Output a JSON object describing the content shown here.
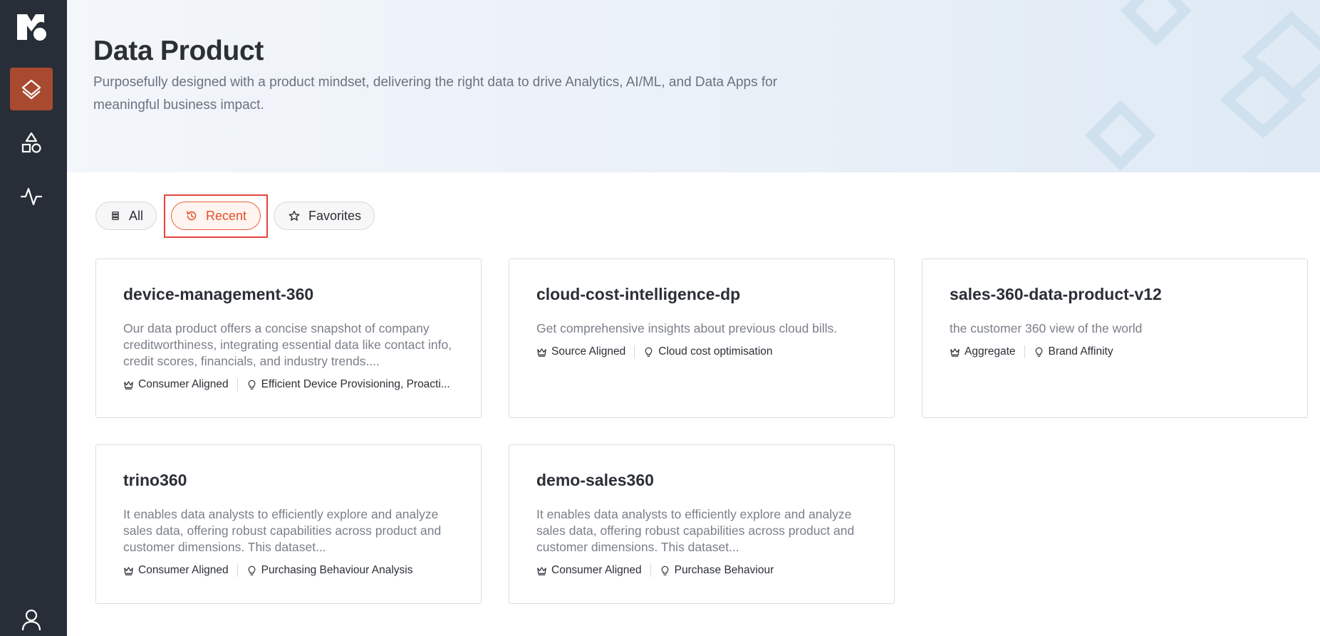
{
  "sidebar": {
    "logo_icon": "brand-logo-icon",
    "items": [
      {
        "name": "layers-icon",
        "active": true
      },
      {
        "name": "shapes-icon",
        "active": false
      },
      {
        "name": "activity-icon",
        "active": false
      }
    ],
    "user_icon": "user-icon",
    "colors": {
      "background": "#282e38",
      "active": "#a84a30"
    }
  },
  "header": {
    "title": "Data Product",
    "subtitle": "Purposefully designed with a product mindset, delivering the right data to drive Analytics, AI/ML, and Data Apps for meaningful business impact."
  },
  "filters": {
    "all_label": "All",
    "recent_label": "Recent",
    "favorites_label": "Favorites",
    "selected": "Recent",
    "accent_color": "#e0512d"
  },
  "cards": [
    {
      "title": "device-management-360",
      "description": "Our data product offers a concise snapshot of company creditworthiness, integrating essential data like contact info, credit scores, financials, and industry trends....",
      "type": "Consumer Aligned",
      "domain": "Efficient Device Provisioning, Proacti..."
    },
    {
      "title": "cloud-cost-intelligence-dp",
      "description": "Get comprehensive insights about previous cloud bills.",
      "type": "Source Aligned",
      "domain": "Cloud cost optimisation"
    },
    {
      "title": "sales-360-data-product-v12",
      "description": "the customer 360 view of the world",
      "type": "Aggregate",
      "domain": "Brand Affinity"
    },
    {
      "title": "trino360",
      "description": "It enables data analysts to efficiently explore and analyze sales data, offering robust capabilities across product and customer dimensions. This dataset...",
      "type": "Consumer Aligned",
      "domain": "Purchasing Behaviour Analysis"
    },
    {
      "title": "demo-sales360",
      "description": "It enables data analysts to efficiently explore and analyze sales data, offering robust capabilities across product and customer dimensions. This dataset...",
      "type": "Consumer Aligned",
      "domain": "Purchase Behaviour"
    }
  ]
}
